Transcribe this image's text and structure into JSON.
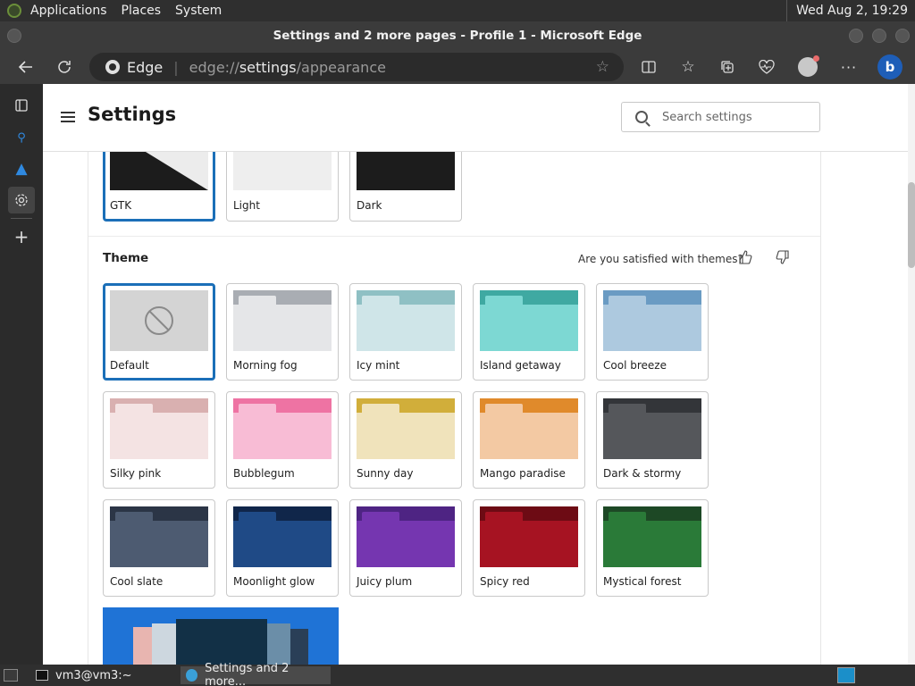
{
  "top_panel": {
    "menus": [
      "Applications",
      "Places",
      "System"
    ],
    "clock": "Wed Aug  2, 19:29"
  },
  "window": {
    "title": "Settings and 2 more pages - Profile 1 - Microsoft Edge"
  },
  "address": {
    "site": "Edge",
    "url_prefix": "edge://",
    "url_main": "settings",
    "url_suffix": "/appearance"
  },
  "settings": {
    "title": "Settings",
    "search_placeholder": "Search settings"
  },
  "modes": [
    {
      "label": "GTK",
      "top": "#1c1c1c",
      "selected": true
    },
    {
      "label": "Light",
      "top": "#eeeeee",
      "selected": false
    },
    {
      "label": "Dark",
      "top": "#1c1c1c",
      "selected": false
    }
  ],
  "theme_section": {
    "title": "Theme",
    "feedback": "Are you satisfied with themes?"
  },
  "themes": [
    {
      "label": "Default",
      "hdr": "#d4d4d4",
      "tab": "#d4d4d4",
      "body": "#d4d4d4",
      "selected": true
    },
    {
      "label": "Morning fog",
      "hdr": "#a9adb3",
      "tab": "#e5e6e8",
      "body": "#e5e6e8"
    },
    {
      "label": "Icy mint",
      "hdr": "#8fc0c4",
      "tab": "#cfe5e8",
      "body": "#cfe5e8"
    },
    {
      "label": "Island getaway",
      "hdr": "#3fa9a2",
      "tab": "#7dd8d3",
      "body": "#7dd8d3"
    },
    {
      "label": "Cool breeze",
      "hdr": "#6a9bc3",
      "tab": "#adc9df",
      "body": "#adc9df"
    },
    {
      "label": "Silky pink",
      "hdr": "#d9b0b0",
      "tab": "#f4e3e3",
      "body": "#f4e3e3"
    },
    {
      "label": "Bubblegum",
      "hdr": "#ee73a3",
      "tab": "#f8bcd5",
      "body": "#f8bcd5"
    },
    {
      "label": "Sunny day",
      "hdr": "#d1ae3a",
      "tab": "#f0e3bb",
      "body": "#f0e3bb"
    },
    {
      "label": "Mango paradise",
      "hdr": "#e08a2b",
      "tab": "#f3c9a3",
      "body": "#f3c9a3"
    },
    {
      "label": "Dark & stormy",
      "hdr": "#333539",
      "tab": "#55575b",
      "body": "#55575b"
    },
    {
      "label": "Cool slate",
      "hdr": "#2b3546",
      "tab": "#4d5b71",
      "body": "#4d5b71"
    },
    {
      "label": "Moonlight glow",
      "hdr": "#10264a",
      "tab": "#1f4a86",
      "body": "#1f4a86"
    },
    {
      "label": "Juicy plum",
      "hdr": "#4e2483",
      "tab": "#7536b0",
      "body": "#7536b0"
    },
    {
      "label": "Spicy red",
      "hdr": "#6d0b14",
      "tab": "#a61322",
      "body": "#a61322"
    },
    {
      "label": "Mystical forest",
      "hdr": "#1d4825",
      "tab": "#2a7a38",
      "body": "#2a7a38"
    }
  ],
  "taskbar": {
    "terminal": "vm3@vm3:~",
    "edge": "Settings and 2 more..."
  }
}
